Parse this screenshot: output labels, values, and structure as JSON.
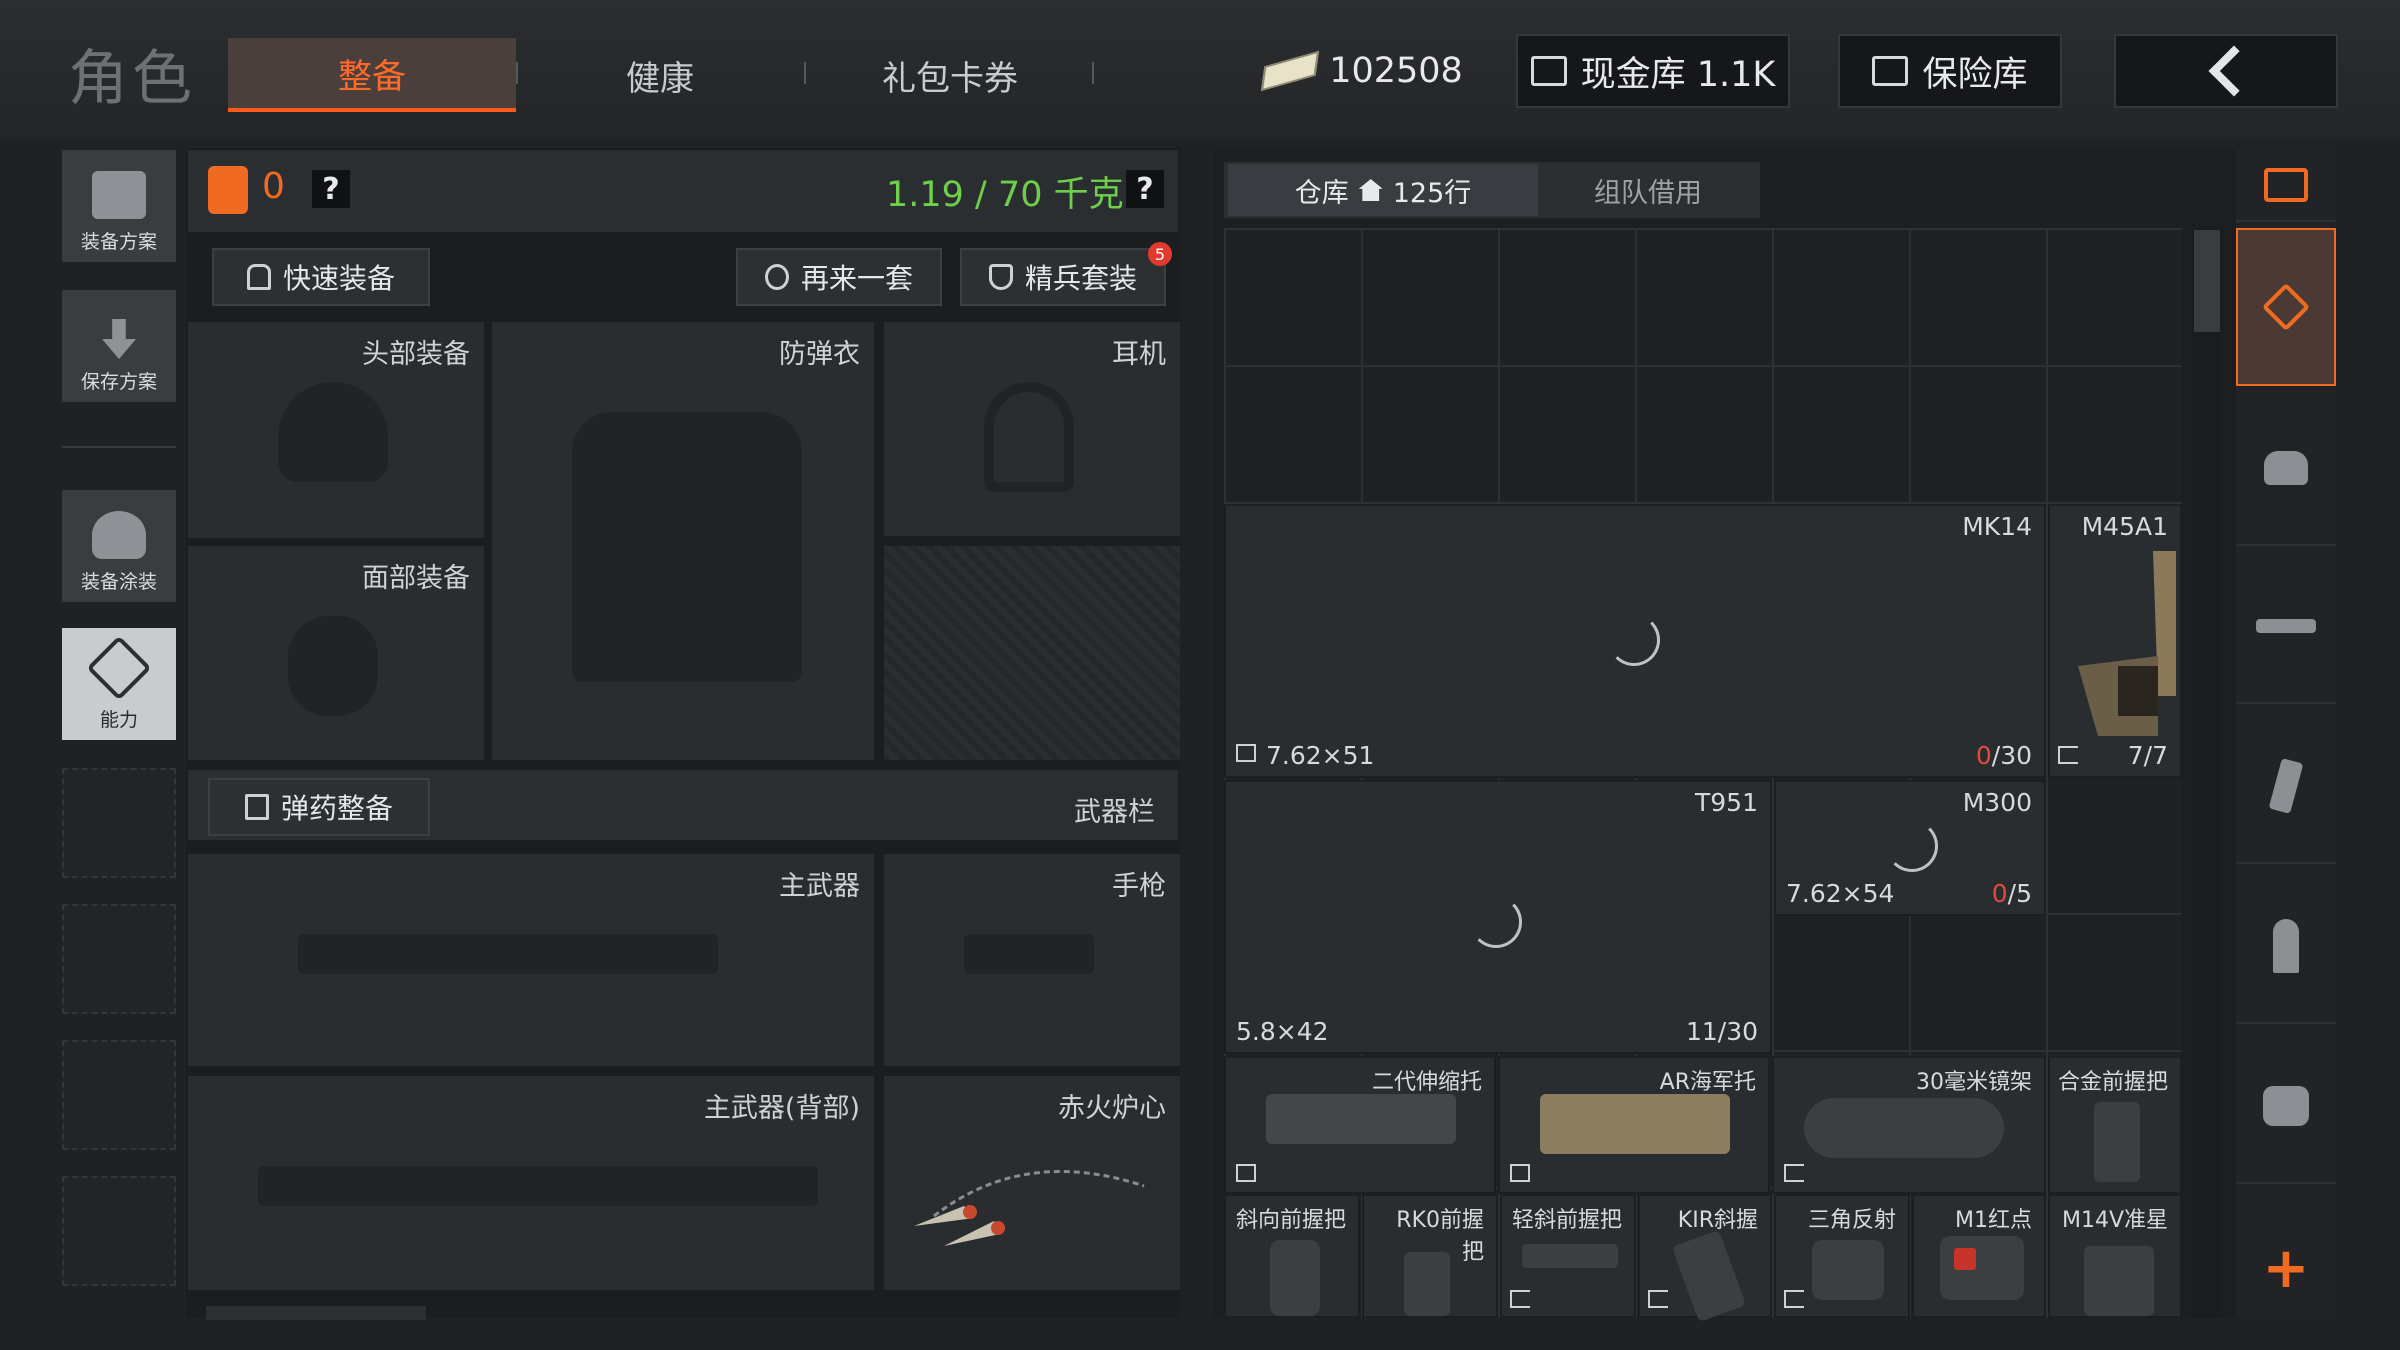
{
  "header": {
    "title": "角色",
    "tabs": [
      "整备",
      "健康",
      "礼包卡券"
    ],
    "money": "102508",
    "cash_vault": "现金库 1.1K",
    "safe_vault": "保险库"
  },
  "sidebar": {
    "items": [
      {
        "label": "装备方案",
        "icon": "vest-icon"
      },
      {
        "label": "保存方案",
        "icon": "download-icon"
      },
      {
        "label": "装备涂装",
        "icon": "helmet-paint-icon"
      },
      {
        "label": "能力",
        "icon": "ability-icon"
      }
    ]
  },
  "equip": {
    "bag_count": "0",
    "help": "?",
    "weight": "1.19 / 70 千克",
    "quick_equip": "快速装备",
    "again": "再来一套",
    "elite": "精兵套装",
    "elite_badge": "5",
    "slots": {
      "head": "头部装备",
      "armor": "防弹衣",
      "ear": "耳机",
      "face": "面部装备",
      "main": "主武器",
      "pistol": "手枪",
      "back": "主武器(背部)",
      "melee": "赤火炉心"
    },
    "ammo_btn": "弹药整备",
    "weapon_col": "武器栏"
  },
  "warehouse": {
    "tab_store": "仓库",
    "rows": "125行",
    "tab_team": "组队借用",
    "items": [
      {
        "name": "MK14",
        "caliber": "7.62×51",
        "ammo_cur": "0",
        "ammo_max": "/30"
      },
      {
        "name": "M45A1",
        "ammo": "7/7"
      },
      {
        "name": "T951",
        "caliber": "5.8×42",
        "ammo": "11/30"
      },
      {
        "name": "M300",
        "caliber": "7.62×54",
        "ammo_cur": "0",
        "ammo_max": "/5"
      }
    ],
    "attachments_row1": [
      "二代伸缩托",
      "AR海军托",
      "30毫米镜架",
      "合金前握把"
    ],
    "attachments_row2": [
      "斜向前握把",
      "RK0前握把",
      "轻斜前握把",
      "KIR斜握",
      "三角反射",
      "M1红点",
      "M14V准星"
    ]
  },
  "colors": {
    "accent": "#f06a21",
    "weight_ok": "#6ed04a",
    "ammo_empty": "#e24b3b",
    "panel": "#2a2d30"
  }
}
